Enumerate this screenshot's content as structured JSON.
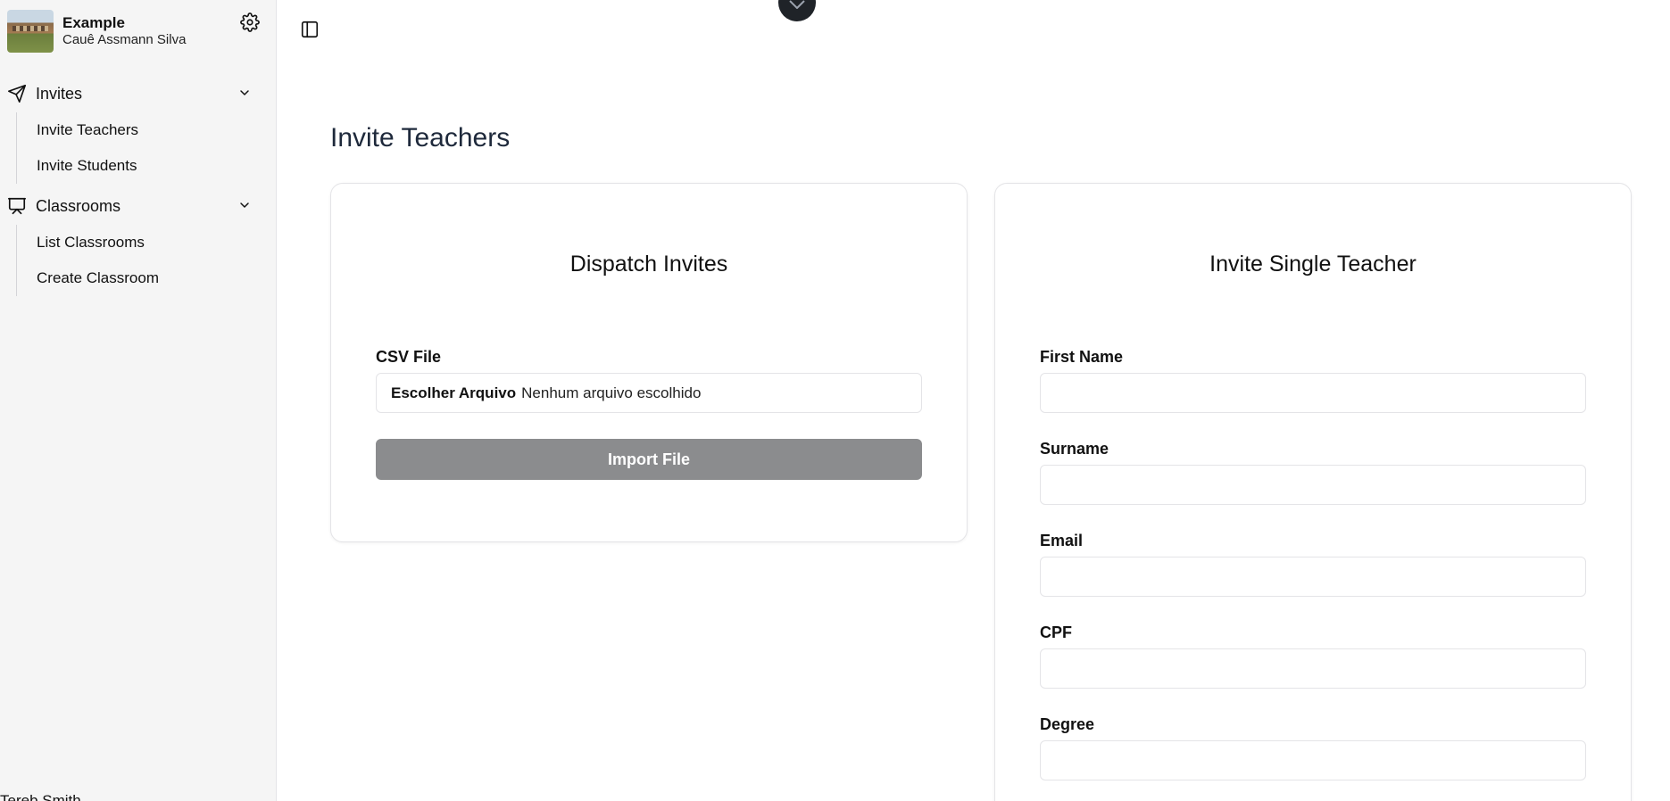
{
  "sidebar": {
    "org_name": "Example",
    "user_name": "Cauê Assmann Silva",
    "groups": [
      {
        "label": "Invites",
        "icon": "send-icon",
        "items": [
          {
            "label": "Invite Teachers"
          },
          {
            "label": "Invite Students"
          }
        ]
      },
      {
        "label": "Classrooms",
        "icon": "presentation-icon",
        "items": [
          {
            "label": "List Classrooms"
          },
          {
            "label": "Create Classroom"
          }
        ]
      }
    ],
    "footer_text": "Tereb Smith"
  },
  "main": {
    "page_title": "Invite Teachers",
    "dispatch_card": {
      "title": "Dispatch Invites",
      "csv_label": "CSV File",
      "file_button": "Escolher Arquivo",
      "file_status": "Nenhum arquivo escolhido",
      "import_button": "Import File"
    },
    "single_card": {
      "title": "Invite Single Teacher",
      "fields": [
        {
          "label": "First Name",
          "value": ""
        },
        {
          "label": "Surname",
          "value": ""
        },
        {
          "label": "Email",
          "value": ""
        },
        {
          "label": "CPF",
          "value": ""
        },
        {
          "label": "Degree",
          "value": ""
        }
      ]
    }
  },
  "colors": {
    "sidebar_bg": "#f5f5f5",
    "title": "#1e293b",
    "disabled_button": "#8b8c8e",
    "border": "#e4e4e7"
  }
}
